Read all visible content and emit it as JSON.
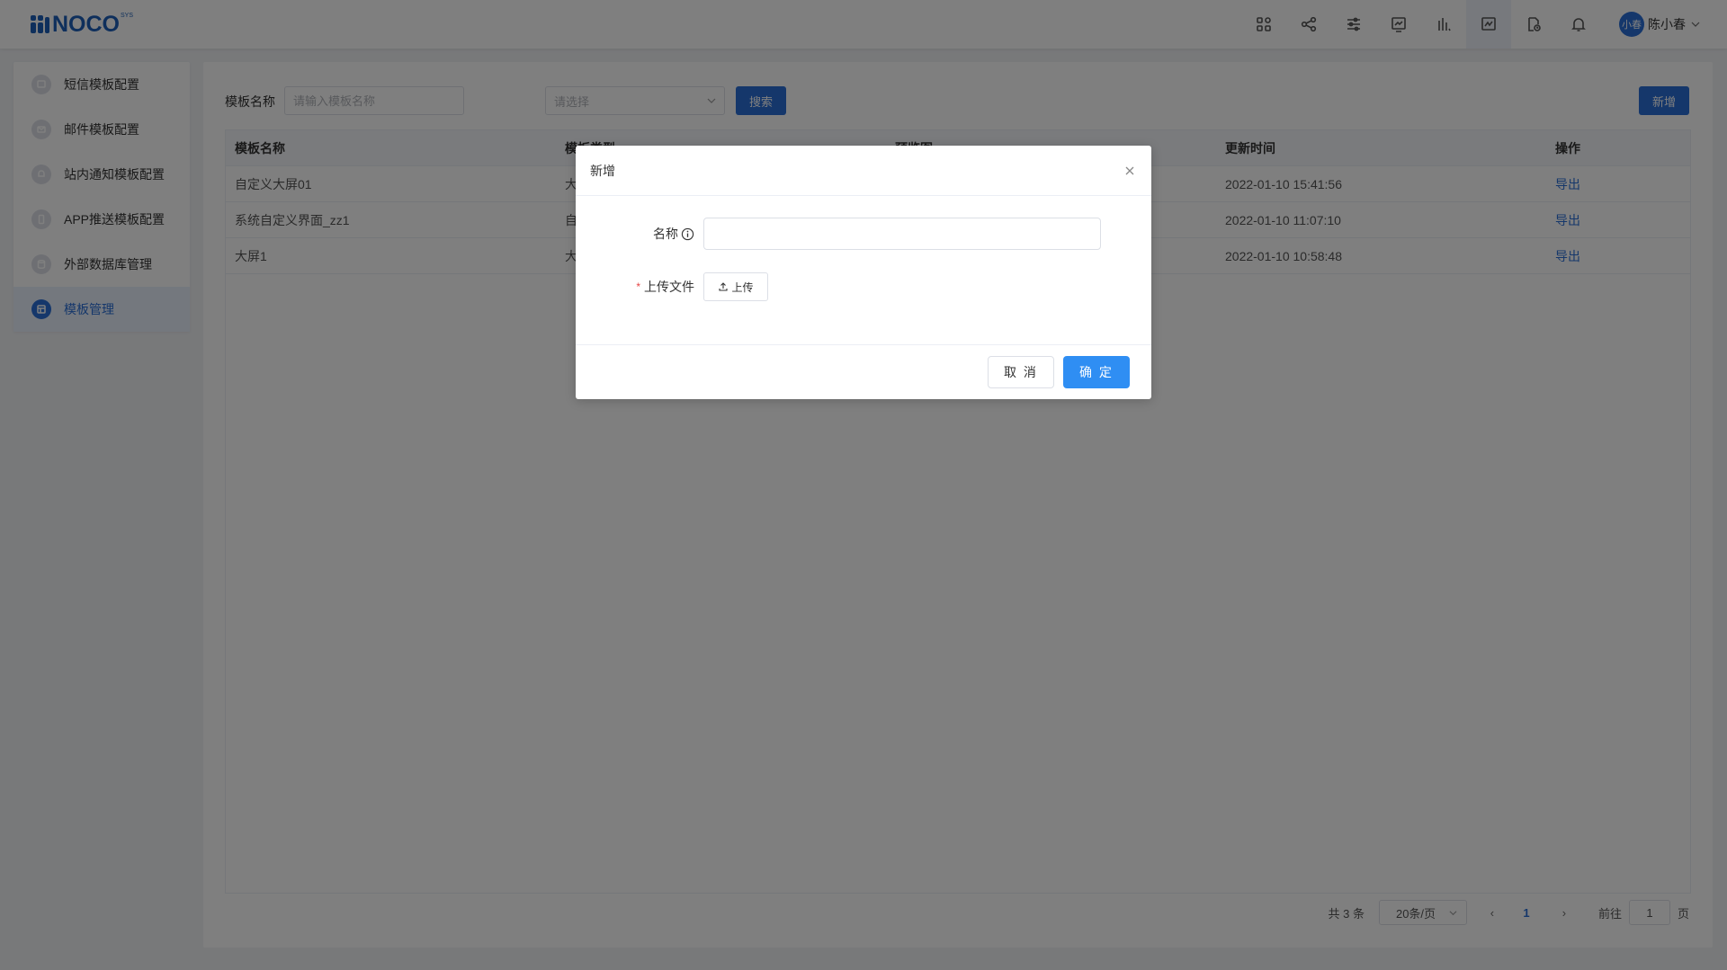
{
  "brand": {
    "name": "NOCO",
    "sup": "SYS"
  },
  "header": {
    "icons": [
      "apps-icon",
      "share-icon",
      "sliders-icon",
      "monitor-chart-icon",
      "bars-icon",
      "dashboard-icon",
      "document-clock-icon",
      "bell-icon"
    ],
    "user": {
      "avatar_text": "小春",
      "name": "陈小春"
    }
  },
  "sidebar": {
    "items": [
      {
        "label": "短信模板配置",
        "icon": "message-icon"
      },
      {
        "label": "邮件模板配置",
        "icon": "mail-icon"
      },
      {
        "label": "站内通知模板配置",
        "icon": "bell-icon"
      },
      {
        "label": "APP推送模板配置",
        "icon": "phone-icon"
      },
      {
        "label": "外部数据库管理",
        "icon": "database-icon"
      },
      {
        "label": "模板管理",
        "icon": "template-icon",
        "active": true
      }
    ]
  },
  "filter": {
    "name_label": "模板名称",
    "name_placeholder": "请输入模板名称",
    "select_placeholder": "请选择",
    "search_label": "搜索",
    "add_label": "新增"
  },
  "table": {
    "headers": [
      "模板名称",
      "模板类型",
      "预览图",
      "更新时间",
      "操作"
    ],
    "rows": [
      {
        "name": "自定义大屏01",
        "type": "大",
        "time": "2022-01-10 15:41:56",
        "action": "导出"
      },
      {
        "name": "系统自定义界面_zz1",
        "type": "自",
        "time": "2022-01-10 11:07:10",
        "action": "导出"
      },
      {
        "name": "大屏1",
        "type": "大",
        "time": "2022-01-10 10:58:48",
        "action": "导出"
      }
    ]
  },
  "pagination": {
    "total": "共 3 条",
    "page_size": "20条/页",
    "current": "1",
    "goto_prefix": "前往",
    "goto_value": "1",
    "goto_suffix": "页"
  },
  "dialog": {
    "title": "新增",
    "name_label": "名称",
    "file_label": "上传文件",
    "upload_label": "上传",
    "cancel_label": "取 消",
    "ok_label": "确 定"
  },
  "colors": {
    "primary": "#2b6fd6",
    "ok_button": "#2f8ef3",
    "required": "#e64545"
  }
}
